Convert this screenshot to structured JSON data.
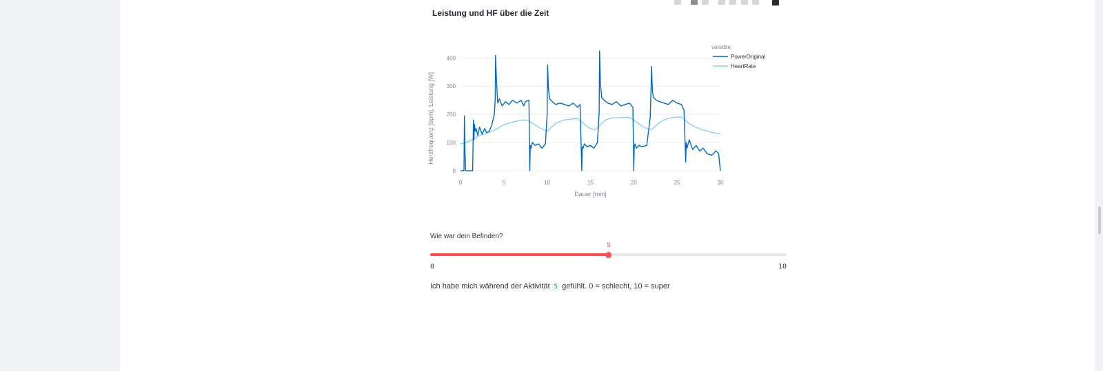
{
  "colors": {
    "power": "#0068c9",
    "heart": "#83c9ff",
    "slider": "#ff4b4b",
    "code": "#09ab3b"
  },
  "modebar": {
    "icons": [
      "camera-icon",
      "zoom-icon",
      "pan-icon",
      "zoom-in-icon",
      "zoom-out-icon",
      "autoscale-icon",
      "reset-axes-icon",
      "plotly-logo-icon"
    ]
  },
  "chart_data": {
    "type": "line",
    "title": "Leistung und HF über die Zeit",
    "xlabel": "Dauer [min]",
    "ylabel": "Herzfrequenz [bpm], Leistung [W]",
    "xlim": [
      0,
      30
    ],
    "ylim": [
      0,
      430
    ],
    "xticks": [
      "0",
      "5",
      "10",
      "15",
      "20",
      "25",
      "30"
    ],
    "yticks": [
      "0",
      "100",
      "200",
      "300",
      "400"
    ],
    "grid": true,
    "legend": {
      "title": "variable",
      "position": "top-right"
    },
    "series": [
      {
        "name": "PowerOriginal",
        "x": [
          0,
          0.3,
          0.4,
          0.45,
          0.5,
          0.55,
          0.6,
          0.65,
          1.4,
          1.5,
          1.55,
          1.6,
          1.7,
          1.8,
          2.0,
          2.2,
          2.5,
          2.8,
          3.0,
          3.3,
          3.6,
          3.9,
          4.0,
          4.05,
          4.15,
          4.3,
          4.5,
          4.8,
          5.2,
          5.6,
          6.0,
          6.5,
          7.0,
          7.3,
          7.5,
          7.9,
          8.0,
          8.05,
          8.15,
          8.3,
          8.6,
          9.0,
          9.4,
          9.8,
          10.0,
          10.05,
          10.15,
          10.3,
          10.6,
          11.0,
          11.5,
          12.0,
          12.5,
          13.0,
          13.5,
          13.8,
          14.0,
          14.05,
          14.15,
          14.3,
          14.6,
          15.0,
          15.4,
          15.8,
          16.0,
          16.05,
          16.15,
          16.3,
          16.6,
          17.0,
          17.5,
          18.0,
          18.5,
          19.0,
          19.5,
          19.9,
          20.0,
          20.05,
          20.15,
          20.3,
          20.6,
          21.0,
          21.5,
          21.9,
          22.0,
          22.05,
          22.15,
          22.3,
          22.6,
          23.0,
          23.5,
          24.0,
          24.5,
          25.0,
          25.5,
          25.8,
          26.0,
          26.05,
          26.15,
          26.4,
          26.8,
          27.2,
          27.6,
          28.0,
          28.5,
          29.0,
          29.5,
          29.8,
          29.9,
          30.0
        ],
        "y": [
          0,
          0,
          0,
          195,
          90,
          40,
          0,
          0,
          0,
          180,
          110,
          165,
          140,
          150,
          125,
          155,
          130,
          150,
          135,
          140,
          160,
          200,
          250,
          410,
          320,
          240,
          255,
          230,
          245,
          235,
          250,
          240,
          250,
          230,
          245,
          250,
          0,
          90,
          80,
          100,
          90,
          95,
          80,
          95,
          200,
          375,
          290,
          255,
          245,
          235,
          240,
          235,
          230,
          240,
          225,
          235,
          0,
          85,
          80,
          95,
          85,
          90,
          80,
          100,
          205,
          425,
          310,
          260,
          250,
          240,
          235,
          245,
          230,
          235,
          240,
          225,
          0,
          85,
          95,
          80,
          90,
          85,
          90,
          190,
          300,
          370,
          280,
          260,
          250,
          245,
          240,
          235,
          250,
          240,
          235,
          215,
          30,
          100,
          80,
          110,
          75,
          90,
          70,
          80,
          60,
          55,
          70,
          60,
          30,
          0
        ]
      },
      {
        "name": "HeartRate",
        "x": [
          0,
          0.5,
          1.0,
          1.5,
          2.0,
          2.5,
          3.0,
          3.5,
          4.0,
          4.5,
          5.0,
          5.5,
          6.0,
          6.5,
          7.0,
          7.5,
          8.0,
          8.5,
          9.0,
          9.5,
          10.0,
          10.5,
          11.0,
          11.5,
          12.0,
          12.5,
          13.0,
          13.5,
          14.0,
          14.5,
          15.0,
          15.5,
          16.0,
          16.5,
          17.0,
          17.5,
          18.0,
          18.5,
          19.0,
          19.5,
          20.0,
          20.5,
          21.0,
          21.5,
          22.0,
          22.5,
          23.0,
          23.5,
          24.0,
          24.5,
          25.0,
          25.5,
          26.0,
          26.5,
          27.0,
          27.5,
          28.0,
          28.5,
          29.0,
          29.5,
          30.0
        ],
        "y": [
          95,
          98,
          105,
          112,
          122,
          128,
          133,
          138,
          145,
          155,
          163,
          168,
          173,
          176,
          179,
          180,
          175,
          165,
          155,
          147,
          140,
          155,
          168,
          175,
          180,
          182,
          184,
          185,
          173,
          160,
          150,
          145,
          158,
          175,
          183,
          187,
          188,
          188,
          189,
          189,
          180,
          168,
          157,
          150,
          146,
          158,
          172,
          180,
          186,
          189,
          190,
          191,
          178,
          165,
          157,
          150,
          145,
          140,
          136,
          133,
          131
        ]
      }
    ]
  },
  "slider": {
    "label": "Wie war dein Befinden?",
    "value": "5",
    "min": "0",
    "max": "10"
  },
  "result": {
    "prefix": "Ich habe mich während der Aktivität",
    "value": "5",
    "suffix": "gefühlt. 0 = schlecht, 10 = super"
  }
}
